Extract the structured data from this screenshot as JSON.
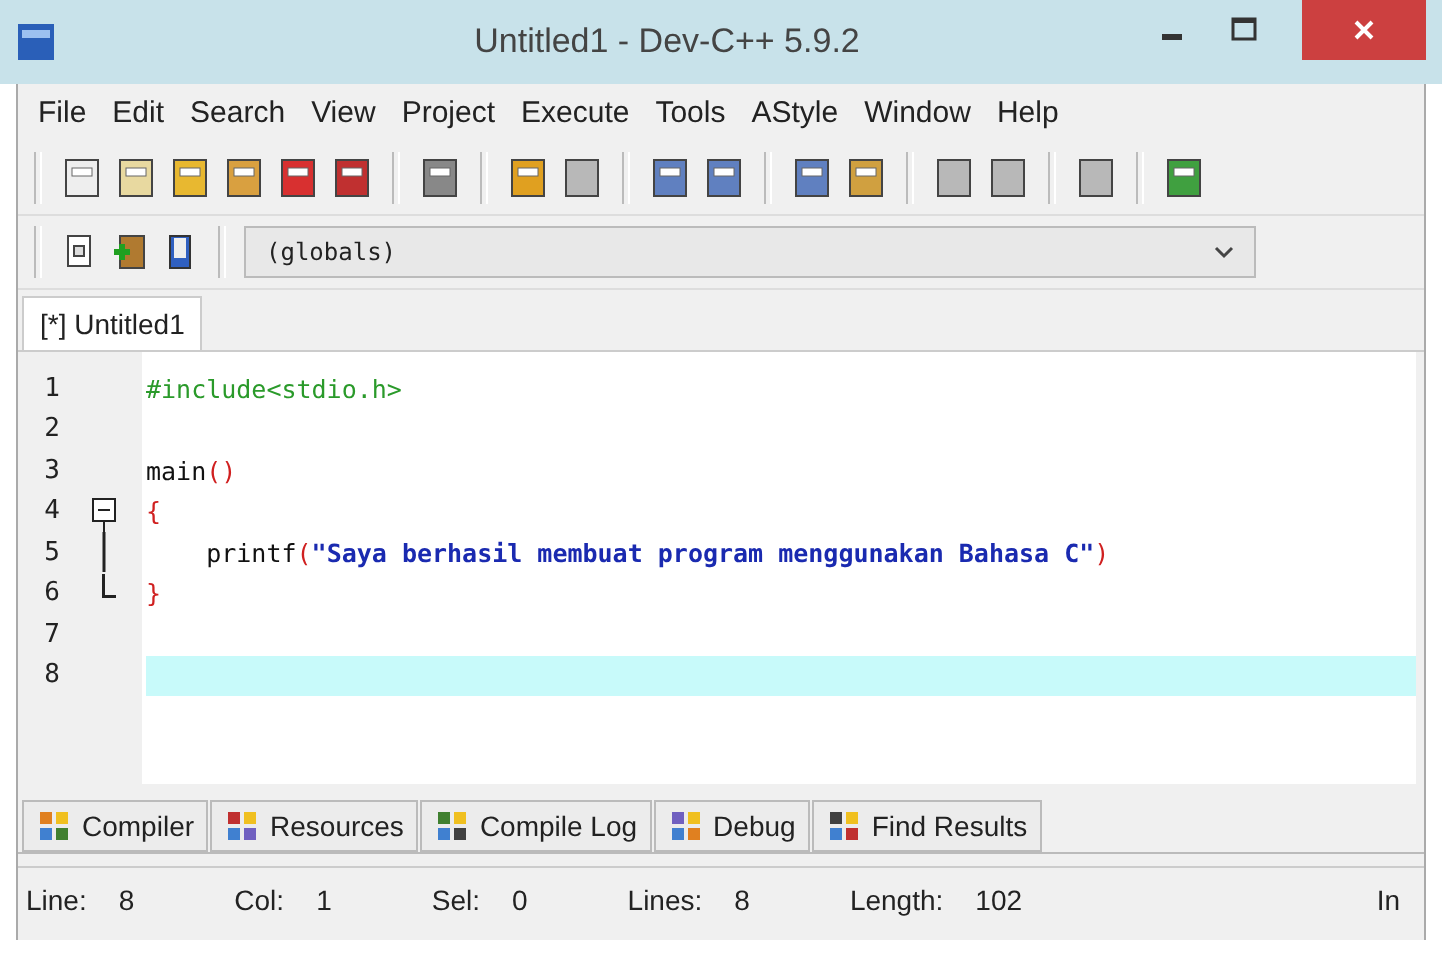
{
  "window": {
    "title": "Untitled1 - Dev-C++ 5.9.2"
  },
  "menu": [
    "File",
    "Edit",
    "Search",
    "View",
    "Project",
    "Execute",
    "Tools",
    "AStyle",
    "Window",
    "Help"
  ],
  "toolbar": [
    {
      "disabled": false
    },
    {
      "disabled": false
    },
    {
      "disabled": false
    },
    {
      "disabled": false
    },
    {
      "disabled": false
    },
    {
      "disabled": false
    },
    {
      "disabled": false
    },
    {
      "disabled": false
    },
    {
      "disabled": true
    },
    {
      "disabled": false
    },
    {
      "disabled": false
    },
    {
      "disabled": false
    },
    {
      "disabled": false
    },
    {
      "disabled": true
    },
    {
      "disabled": true
    },
    {
      "disabled": true
    },
    {
      "disabled": false
    }
  ],
  "scope_box": {
    "value": "(globals)"
  },
  "editor_tabs": [
    {
      "label": "[*] Untitled1",
      "selected": true
    }
  ],
  "code_lines": [
    {
      "number": "1",
      "tokens": [
        {
          "kind": "preproc",
          "text": "#include<stdio.h>"
        }
      ]
    },
    {
      "number": "2"
    },
    {
      "number": "3",
      "tokens": [
        {
          "kind": "plain",
          "text": "main"
        },
        {
          "kind": "symbol",
          "text": "()"
        }
      ]
    },
    {
      "number": "4",
      "fold_open": true,
      "tokens": [
        {
          "kind": "symbol",
          "text": "{"
        }
      ]
    },
    {
      "number": "5",
      "fold_inside": true,
      "tokens": [
        {
          "kind": "plain",
          "text": "    printf"
        },
        {
          "kind": "symbol",
          "text": "("
        },
        {
          "kind": "string",
          "text": "\"Saya berhasil membuat program menggunakan Bahasa C\""
        },
        {
          "kind": "symbol",
          "text": ")"
        }
      ]
    },
    {
      "number": "6",
      "fold_close": true,
      "tokens": [
        {
          "kind": "symbol",
          "text": "}"
        }
      ]
    },
    {
      "number": "7"
    },
    {
      "number": "8",
      "current": true
    }
  ],
  "bottom_tabs": [
    {
      "label": "Compiler",
      "selected": false
    },
    {
      "label": "Resources",
      "selected": false
    },
    {
      "label": "Compile Log",
      "selected": false
    },
    {
      "label": "Debug",
      "selected": false
    },
    {
      "label": "Find Results",
      "selected": false
    }
  ],
  "status_bar": [
    {
      "label": "Line:",
      "value": "8"
    },
    {
      "label": "Col:",
      "value": "1"
    },
    {
      "label": "Sel:",
      "value": "0"
    },
    {
      "label": "Lines:",
      "value": "8"
    },
    {
      "label": "Length:",
      "value": "102"
    },
    {
      "label": "In"
    }
  ]
}
